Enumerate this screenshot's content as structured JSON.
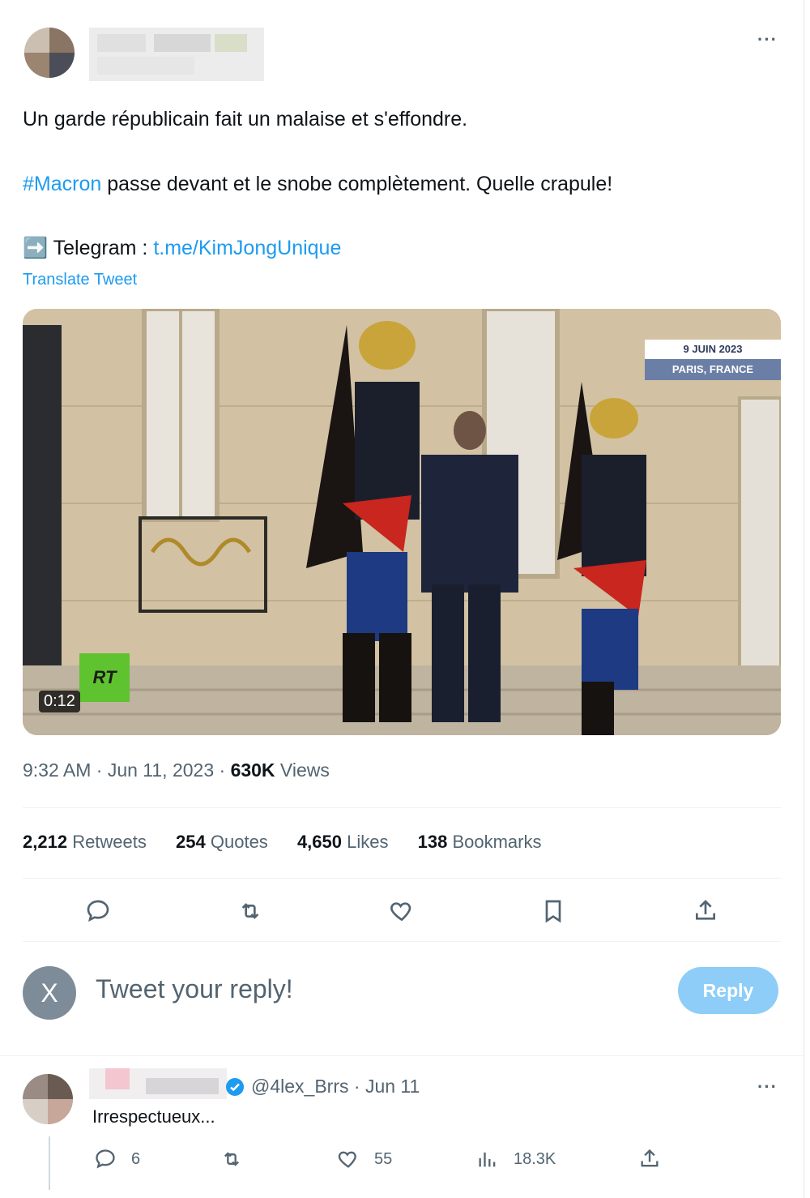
{
  "tweet": {
    "line1": "Un garde républicain fait un malaise et s'effondre.",
    "hashtag": "#Macron",
    "line2_rest": " passe devant et le snobe complètement. Quelle crapule!",
    "telegram_arrow": "➡️",
    "telegram_label": "Telegram : ",
    "telegram_link": "t.me/KimJongUnique",
    "translate": "Translate Tweet",
    "more": "···"
  },
  "media": {
    "date_badge": "9 JUIN 2023",
    "location_badge": "PARIS, FRANCE",
    "logo": "RT",
    "duration": "0:12"
  },
  "meta": {
    "time": "9:32 AM · Jun 11, 2023 · ",
    "views_count": "630K",
    "views_label": " Views"
  },
  "stats": [
    {
      "count": "2,212",
      "label": "Retweets"
    },
    {
      "count": "254",
      "label": "Quotes"
    },
    {
      "count": "4,650",
      "label": "Likes"
    },
    {
      "count": "138",
      "label": "Bookmarks"
    }
  ],
  "actions": [
    "reply-icon",
    "retweet-icon",
    "like-icon",
    "bookmark-icon",
    "share-icon"
  ],
  "composer": {
    "avatar_letter": "X",
    "placeholder": "Tweet your reply!",
    "button": "Reply"
  },
  "reply": {
    "handle": "@4lex_Brrs",
    "date": " · Jun 11",
    "text": "Irrespectueux...",
    "more": "···",
    "replies": "6",
    "likes": "55",
    "views": "18.3K"
  },
  "colors": {
    "accent": "#1d9bf0",
    "button_disabled": "#8ecdf8",
    "muted": "#536471"
  }
}
